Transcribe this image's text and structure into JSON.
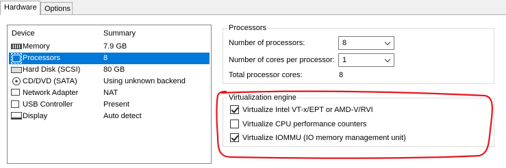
{
  "tabs": [
    {
      "label": "Hardware",
      "active": true
    },
    {
      "label": "Options",
      "active": false
    }
  ],
  "device_list": {
    "columns": {
      "device": "Device",
      "summary": "Summary"
    },
    "rows": [
      {
        "icon": "memory-icon",
        "name": "Memory",
        "summary": "7.9 GB",
        "selected": false
      },
      {
        "icon": "processor-icon",
        "name": "Processors",
        "summary": "8",
        "selected": true
      },
      {
        "icon": "hard-disk-icon",
        "name": "Hard Disk (SCSI)",
        "summary": "80 GB",
        "selected": false
      },
      {
        "icon": "cd-dvd-icon",
        "name": "CD/DVD (SATA)",
        "summary": "Using unknown backend",
        "selected": false
      },
      {
        "icon": "network-adapter-icon",
        "name": "Network Adapter",
        "summary": "NAT",
        "selected": false
      },
      {
        "icon": "usb-controller-icon",
        "name": "USB Controller",
        "summary": "Present",
        "selected": false
      },
      {
        "icon": "display-icon",
        "name": "Display",
        "summary": "Auto detect",
        "selected": false
      }
    ]
  },
  "processors": {
    "title": "Processors",
    "num_processors_label": "Number of processors:",
    "num_processors_value": "8",
    "cores_label": "Number of cores per processor:",
    "cores_value": "1",
    "total_label": "Total processor cores:",
    "total_value": "8"
  },
  "virtualization": {
    "title": "Virtualization engine",
    "options": [
      {
        "label": "Virtualize Intel VT-x/EPT or AMD-V/RVI",
        "checked": true
      },
      {
        "label": "Virtualize CPU performance counters",
        "checked": false
      },
      {
        "label": "Virtualize IOMMU (IO memory management unit)",
        "checked": true
      }
    ]
  },
  "colors": {
    "selection": "#0078d7",
    "annotation": "#e8141c",
    "window_bg": "#f0f0f0"
  }
}
